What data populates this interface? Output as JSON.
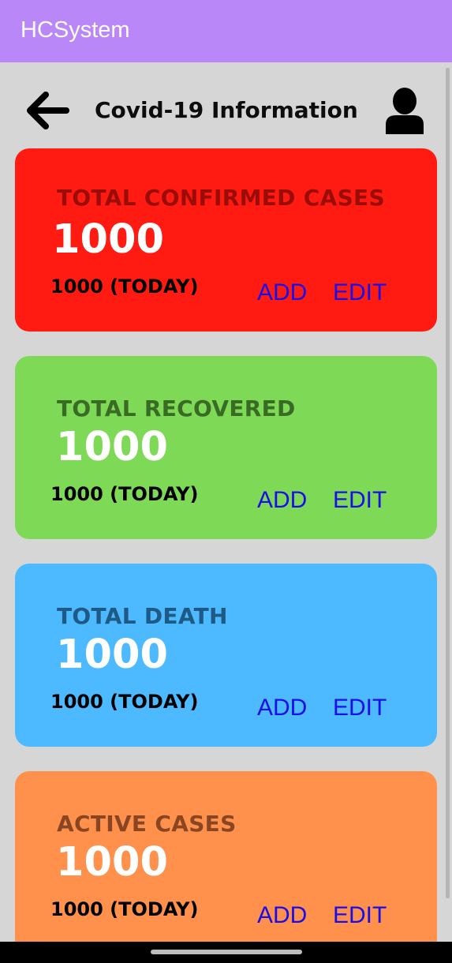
{
  "app_title": "HCSystem",
  "header": {
    "title": "Covid-19 Information"
  },
  "icons": {
    "back": "arrow-left-icon",
    "user": "user-avatar-icon"
  },
  "cards": [
    {
      "title": "TOTAL CONFIRMED CASES",
      "value": "1000",
      "today": "1000 (TODAY)",
      "add": "ADD",
      "edit": "EDIT",
      "bg": "#ff1a12",
      "title_color": "#9a0c08"
    },
    {
      "title": "TOTAL RECOVERED",
      "value": "1000",
      "today": "1000 (TODAY)",
      "add": "ADD",
      "edit": "EDIT",
      "bg": "#7ed957",
      "title_color": "#3a6b24"
    },
    {
      "title": "TOTAL DEATH",
      "value": "1000",
      "today": "1000 (TODAY)",
      "add": "ADD",
      "edit": "EDIT",
      "bg": "#4db9ff",
      "title_color": "#1e5a85"
    },
    {
      "title": "ACTIVE CASES",
      "value": "1000",
      "today": "1000 (TODAY)",
      "add": "ADD",
      "edit": "EDIT",
      "bg": "#ff914d",
      "title_color": "#8a4622"
    }
  ],
  "colors": {
    "appbar": "#b987f7",
    "background": "#d6d6d6",
    "action_text": "#1a0ee8"
  }
}
